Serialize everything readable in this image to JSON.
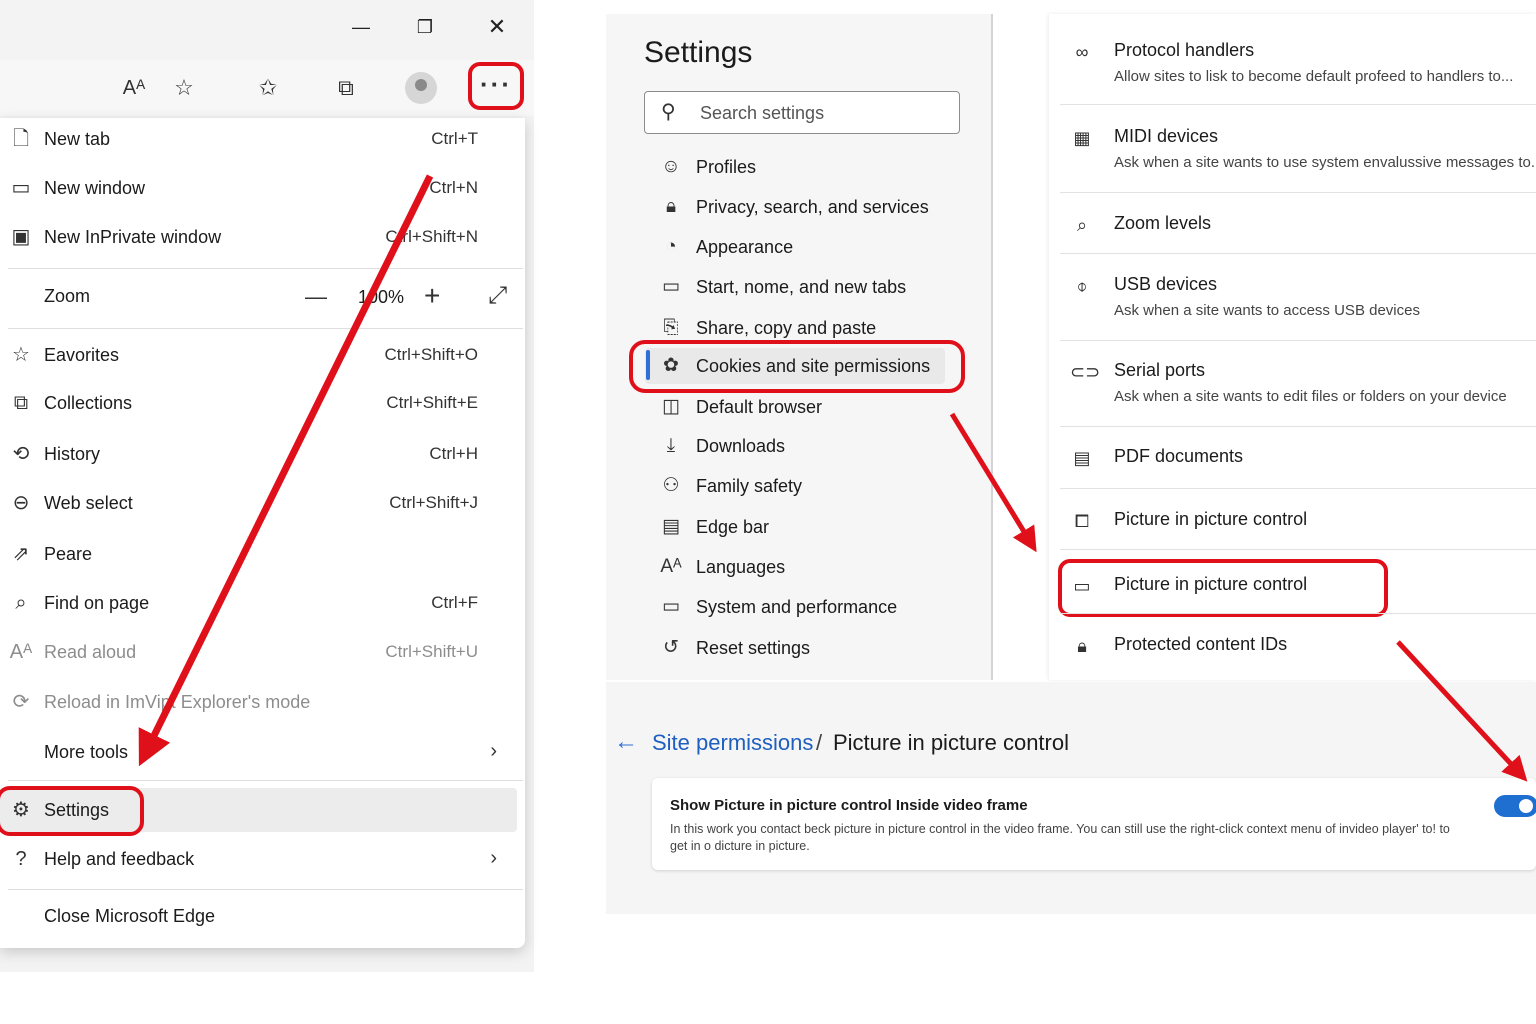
{
  "menu": {
    "items": [
      {
        "label": "New tab",
        "shortcut": "Ctrl+T",
        "icon": "new-tab-icon"
      },
      {
        "label": "New window",
        "shortcut": "Ctrl+N",
        "icon": "new-window-icon"
      },
      {
        "label": "New InPrivate window",
        "shortcut": "Ctrl+Shift+N",
        "icon": "inprivate-icon"
      },
      {
        "label": "Eavorites",
        "shortcut": "Ctrl+Shift+O",
        "icon": "favorites-icon"
      },
      {
        "label": "Collections",
        "shortcut": "Ctrl+Shift+E",
        "icon": "collections-icon"
      },
      {
        "label": "History",
        "shortcut": "Ctrl+H",
        "icon": "history-icon"
      },
      {
        "label": "Web select",
        "shortcut": "Ctrl+Shift+J",
        "icon": "web-select-icon"
      },
      {
        "label": "Peare",
        "shortcut": "",
        "icon": "share-icon"
      },
      {
        "label": "Find on page",
        "shortcut": "Ctrl+F",
        "icon": "find-icon"
      },
      {
        "label": "Read aloud",
        "shortcut": "Ctrl+Shift+U",
        "icon": "read-aloud-icon"
      },
      {
        "label": "Reload in ImVipt Explorer's mode",
        "shortcut": "",
        "icon": "ie-mode-icon"
      },
      {
        "label": "More tools",
        "shortcut": "",
        "icon": ""
      },
      {
        "label": "Settings",
        "shortcut": "",
        "icon": "settings-icon"
      },
      {
        "label": "Help and feedback",
        "shortcut": "",
        "icon": "help-icon"
      },
      {
        "label": "Close Microsoft Edge",
        "shortcut": "",
        "icon": ""
      }
    ],
    "zoom": {
      "label": "Zoom",
      "value": "100%",
      "minus": "—",
      "plus": "+"
    }
  },
  "settings": {
    "title": "Settings",
    "search_placeholder": "Search settings",
    "nav": [
      {
        "label": "Profiles"
      },
      {
        "label": "Privacy, search, and services"
      },
      {
        "label": "Appearance"
      },
      {
        "label": "Start, nome, and new tabs"
      },
      {
        "label": "Share, copy and paste"
      },
      {
        "label": "Cookies and site permissions"
      },
      {
        "label": "Default browser"
      },
      {
        "label": "Downloads"
      },
      {
        "label": "Family safety"
      },
      {
        "label": "Edge bar"
      },
      {
        "label": "Languages"
      },
      {
        "label": "System and performance"
      },
      {
        "label": "Reset settings"
      }
    ]
  },
  "permissions": [
    {
      "title": "Protocol handlers",
      "desc": "Allow sites to lisk to become default profeed to handlers to..."
    },
    {
      "title": "MIDI devices",
      "desc": "Ask when a site wants to use system envalussive messages to...."
    },
    {
      "title": "Zoom levels",
      "desc": ""
    },
    {
      "title": "USB devices",
      "desc": "Ask when a site wants to access USB devices"
    },
    {
      "title": "Serial ports",
      "desc": "Ask when a site wants to edit files or folders on your device"
    },
    {
      "title": "PDF documents",
      "desc": ""
    },
    {
      "title": "Picture in picture control",
      "desc": ""
    },
    {
      "title": "Picture in picture control",
      "desc": ""
    },
    {
      "title": "Protected content IDs",
      "desc": ""
    }
  ],
  "detail": {
    "breadcrumb_link": "Site permissions",
    "breadcrumb_sep": "/",
    "breadcrumb_current": "Picture in picture control",
    "card_title": "Show Picture in picture control Inside video frame",
    "card_desc": "In this work you contact beck picture in picture control in the video frame. You can still use the right-click context menu of invideo player' to! to get in o dicture in picture.",
    "toggle_on": true
  },
  "colors": {
    "accent": "#1f6fd1",
    "annotation": "#e0101b"
  }
}
